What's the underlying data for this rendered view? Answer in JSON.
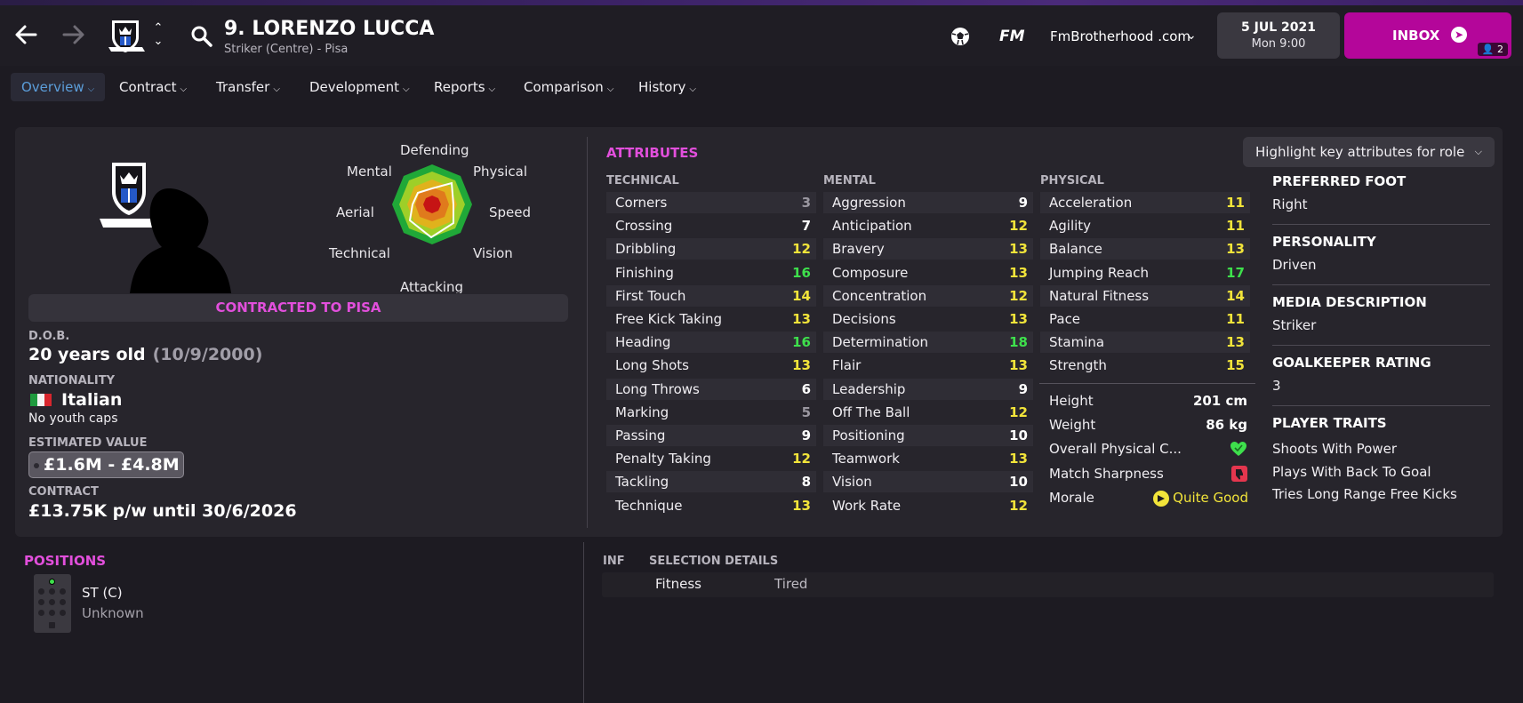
{
  "header": {
    "player_name": "9. LORENZO LUCCA",
    "player_subtitle": "Striker (Centre) - Pisa",
    "fm_logo": "FM",
    "skin_name": "FmBrotherhood .com",
    "date_line1": "5 JUL 2021",
    "date_line2": "Mon 9:00",
    "inbox_label": "INBOX",
    "inbox_badge": "2",
    "icons": {
      "back": "back-arrow-icon",
      "forward": "forward-arrow-icon",
      "crest": "club-crest-icon",
      "search": "search-icon",
      "ball": "football-icon",
      "dropdown": "chevron-down-icon"
    }
  },
  "tabs": [
    {
      "label": "Overview",
      "active": true
    },
    {
      "label": "Contract"
    },
    {
      "label": "Transfer"
    },
    {
      "label": "Development"
    },
    {
      "label": "Reports"
    },
    {
      "label": "Comparison"
    },
    {
      "label": "History"
    }
  ],
  "radar": {
    "labels": [
      "Defending",
      "Physical",
      "Speed",
      "Vision",
      "Attacking",
      "Technical",
      "Aerial",
      "Mental"
    ]
  },
  "profile": {
    "contract_banner": "CONTRACTED TO PISA",
    "dob_label": "D.O.B.",
    "dob_age": "20 years old",
    "dob_date": "(10/9/2000)",
    "nationality_label": "NATIONALITY",
    "nationality": "Italian",
    "youth_caps": "No youth caps",
    "value_label": "ESTIMATED VALUE",
    "value": "£1.6M - £4.8M",
    "contract_label": "CONTRACT",
    "contract": "£13.75K p/w until 30/6/2026"
  },
  "attributes": {
    "title": "ATTRIBUTES",
    "highlight_button": "Highlight key attributes for role",
    "technical_header": "TECHNICAL",
    "mental_header": "MENTAL",
    "physical_header": "PHYSICAL",
    "technical": [
      {
        "name": "Corners",
        "value": "3"
      },
      {
        "name": "Crossing",
        "value": "7"
      },
      {
        "name": "Dribbling",
        "value": "12"
      },
      {
        "name": "Finishing",
        "value": "16"
      },
      {
        "name": "First Touch",
        "value": "14"
      },
      {
        "name": "Free Kick Taking",
        "value": "13"
      },
      {
        "name": "Heading",
        "value": "16"
      },
      {
        "name": "Long Shots",
        "value": "13"
      },
      {
        "name": "Long Throws",
        "value": "6"
      },
      {
        "name": "Marking",
        "value": "5"
      },
      {
        "name": "Passing",
        "value": "9"
      },
      {
        "name": "Penalty Taking",
        "value": "12"
      },
      {
        "name": "Tackling",
        "value": "8"
      },
      {
        "name": "Technique",
        "value": "13"
      }
    ],
    "mental": [
      {
        "name": "Aggression",
        "value": "9"
      },
      {
        "name": "Anticipation",
        "value": "12"
      },
      {
        "name": "Bravery",
        "value": "13"
      },
      {
        "name": "Composure",
        "value": "13"
      },
      {
        "name": "Concentration",
        "value": "12"
      },
      {
        "name": "Decisions",
        "value": "13"
      },
      {
        "name": "Determination",
        "value": "18"
      },
      {
        "name": "Flair",
        "value": "13"
      },
      {
        "name": "Leadership",
        "value": "9"
      },
      {
        "name": "Off The Ball",
        "value": "12"
      },
      {
        "name": "Positioning",
        "value": "10"
      },
      {
        "name": "Teamwork",
        "value": "13"
      },
      {
        "name": "Vision",
        "value": "10"
      },
      {
        "name": "Work Rate",
        "value": "12"
      }
    ],
    "physical": [
      {
        "name": "Acceleration",
        "value": "11"
      },
      {
        "name": "Agility",
        "value": "11"
      },
      {
        "name": "Balance",
        "value": "13"
      },
      {
        "name": "Jumping Reach",
        "value": "17"
      },
      {
        "name": "Natural Fitness",
        "value": "14"
      },
      {
        "name": "Pace",
        "value": "11"
      },
      {
        "name": "Stamina",
        "value": "13"
      },
      {
        "name": "Strength",
        "value": "15"
      }
    ],
    "physical_extra": {
      "height_label": "Height",
      "height": "201 cm",
      "weight_label": "Weight",
      "weight": "86 kg",
      "overall_label": "Overall Physical C...",
      "sharpness_label": "Match Sharpness",
      "morale_label": "Morale",
      "morale": "Quite Good"
    }
  },
  "side_info": {
    "foot_label": "PREFERRED FOOT",
    "foot": "Right",
    "personality_label": "PERSONALITY",
    "personality": "Driven",
    "media_label": "MEDIA DESCRIPTION",
    "media": "Striker",
    "gk_label": "GOALKEEPER RATING",
    "gk": "3",
    "traits_label": "PLAYER TRAITS",
    "traits": [
      "Shoots With Power",
      "Plays With Back To Goal",
      "Tries Long Range Free Kicks"
    ]
  },
  "positions": {
    "title": "POSITIONS",
    "name": "ST (C)",
    "rating": "Unknown"
  },
  "selection": {
    "inf_header": "INF",
    "details_header": "SELECTION DETAILS",
    "row_label": "Fitness",
    "row_value": "Tired"
  },
  "colors": {
    "accent_magenta": "#e24fdc",
    "inbox": "#b4069a",
    "tab_active": "#5b9dd9",
    "attr_high": "#3ee04c",
    "attr_good": "#f2e43a",
    "attr_mid": "#ffffff",
    "attr_low": "#9a97a0"
  }
}
